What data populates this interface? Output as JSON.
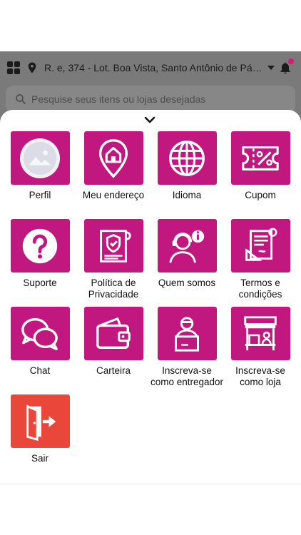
{
  "header": {
    "address": "R. e, 374 - Lot. Boa Vista, Santo Antônio de Pádua...",
    "icons": [
      "grid-icon",
      "location-pin-icon",
      "caret-down-icon",
      "bell-icon"
    ]
  },
  "search": {
    "placeholder": "Pesquise seus itens ou lojas desejadas"
  },
  "menu": [
    {
      "label": "Perfil",
      "icon": "profile-image-icon"
    },
    {
      "label": "Meu endereço",
      "icon": "home-pin-icon"
    },
    {
      "label": "Idioma",
      "icon": "globe-icon"
    },
    {
      "label": "Cupom",
      "icon": "coupon-icon"
    },
    {
      "label": "Suporte",
      "icon": "question-icon"
    },
    {
      "label": "Política de Privacidade",
      "icon": "privacy-policy-icon"
    },
    {
      "label": "Quem somos",
      "icon": "about-us-icon"
    },
    {
      "label": "Termos e condições",
      "icon": "terms-icon"
    },
    {
      "label": "Chat",
      "icon": "chat-icon"
    },
    {
      "label": "Carteira",
      "icon": "wallet-icon"
    },
    {
      "label": "Inscreva-se como entregador",
      "icon": "delivery-man-icon"
    },
    {
      "label": "Inscreva-se como loja",
      "icon": "store-icon"
    },
    {
      "label": "Sair",
      "icon": "logout-icon"
    }
  ],
  "colors": {
    "tile": "#c0187f",
    "logout": "#e8473a",
    "badge": "#d81b78"
  }
}
